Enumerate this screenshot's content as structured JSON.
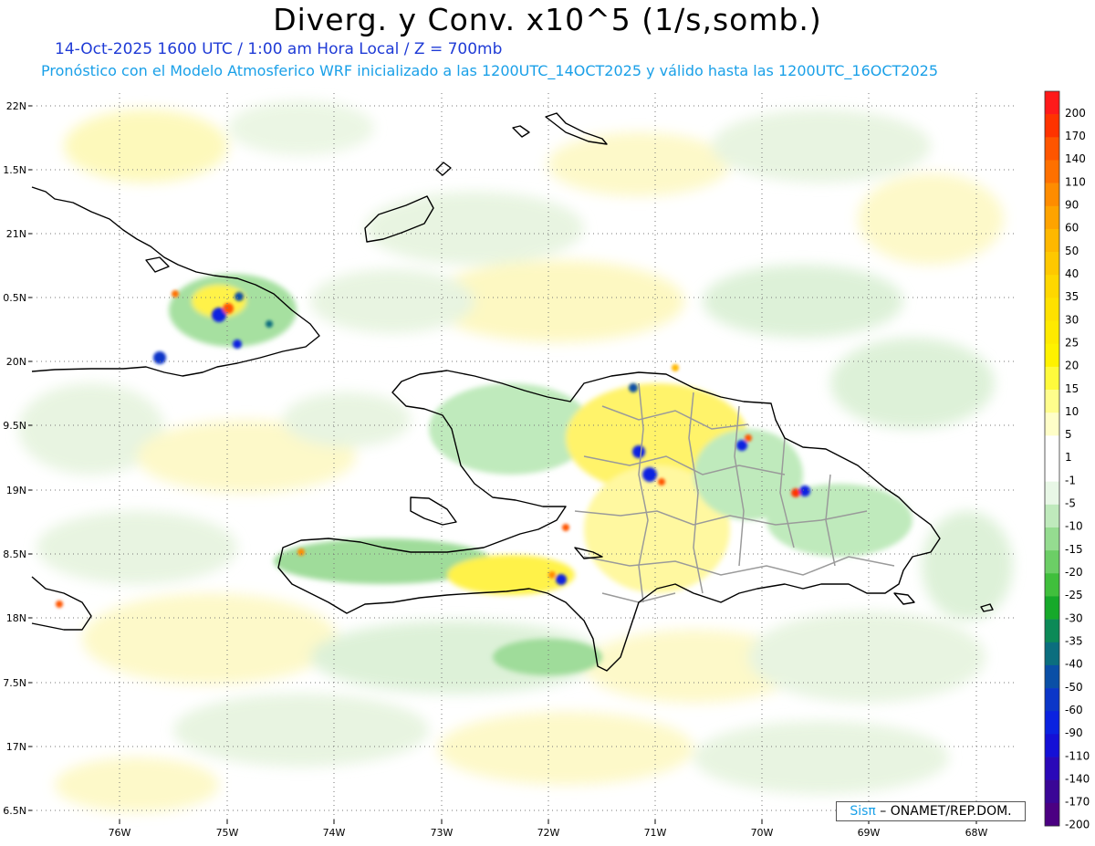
{
  "title": "Diverg. y Conv. x10^5 (1/s,somb.)",
  "subtitle_line1": "14-Oct-2025  1600 UTC / 1:00 am Hora Local / Z = 700mb",
  "subtitle_line2": "Pronóstico con el Modelo Atmosferico WRF inicializado a las 1200UTC_14OCT2025 y válido hasta las  1200UTC_16OCT2025",
  "lat_labels": [
    "22N",
    "1.5N",
    "21N",
    "0.5N",
    "20N",
    "9.5N",
    "19N",
    "8.5N",
    "18N",
    "7.5N",
    "17N",
    "6.5N"
  ],
  "lon_labels": [
    "76W",
    "75W",
    "74W",
    "73W",
    "72W",
    "71W",
    "70W",
    "69W",
    "68W"
  ],
  "colorbar": {
    "labels": [
      "200",
      "170",
      "140",
      "110",
      "90",
      "60",
      "50",
      "40",
      "35",
      "30",
      "25",
      "20",
      "15",
      "10",
      "5",
      "1",
      "-1",
      "-5",
      "-10",
      "-15",
      "-20",
      "-25",
      "-30",
      "-35",
      "-40",
      "-50",
      "-60",
      "-90",
      "-110",
      "-140",
      "-170",
      "-200"
    ],
    "colors": [
      "#ff1a1a",
      "#ff3300",
      "#ff5500",
      "#ff7000",
      "#ff8c00",
      "#ffa300",
      "#ffb800",
      "#ffc800",
      "#ffd700",
      "#ffe100",
      "#ffea00",
      "#fff200",
      "#fffa3c",
      "#fffd8c",
      "#fffec8",
      "#ffffff",
      "#ffffff",
      "#e8f7e6",
      "#bfeabc",
      "#95dc90",
      "#6cce66",
      "#40bf3c",
      "#16a92a",
      "#0c8a57",
      "#0b6e7e",
      "#0a4fa6",
      "#0b36c8",
      "#0a22e0",
      "#1410d6",
      "#2a08b8",
      "#3a0696",
      "#4b0082"
    ]
  },
  "credit": {
    "brand": "Sisπ",
    "text": " – ONAMET/REP.DOM."
  }
}
